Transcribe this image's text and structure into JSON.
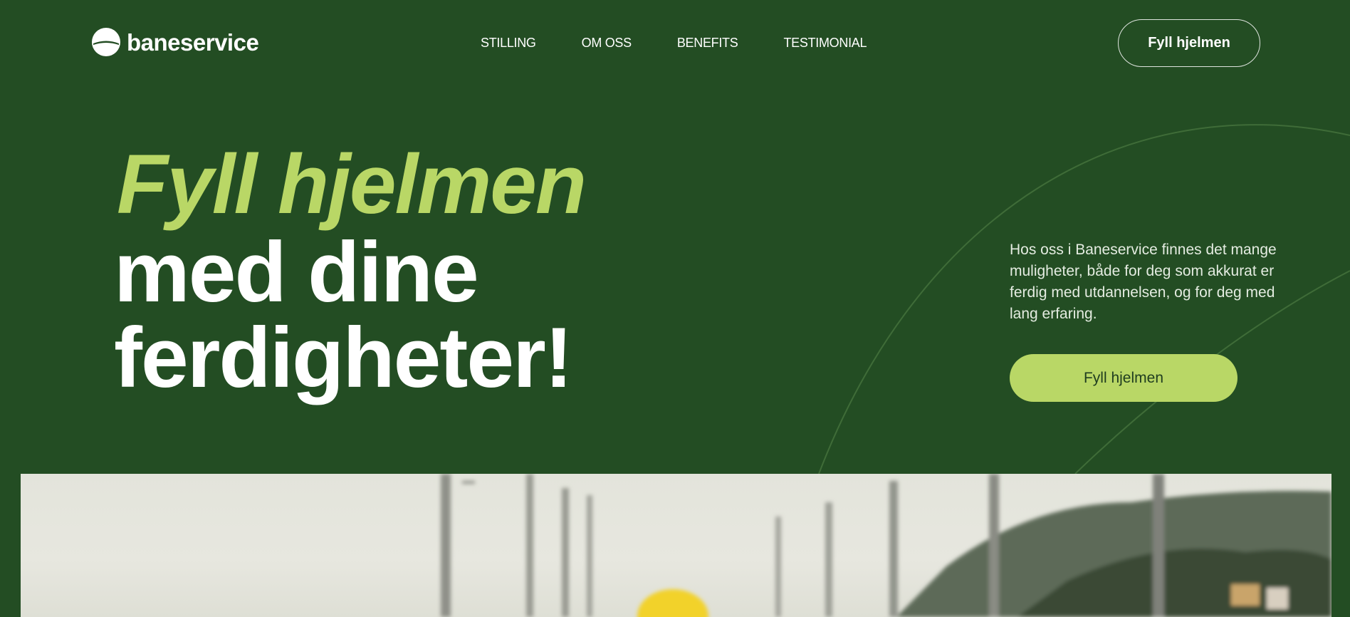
{
  "brand": {
    "name": "baneservice",
    "logo_icon": "baneservice-logo-mark"
  },
  "nav": {
    "items": [
      {
        "label": "STILLING"
      },
      {
        "label": "OM OSS"
      },
      {
        "label": "BENEFITS"
      },
      {
        "label": "TESTIMONIAL"
      }
    ]
  },
  "header": {
    "cta_label": "Fyll hjelmen"
  },
  "hero": {
    "title_line1": "Fyll hjelmen",
    "title_line2": "med dine",
    "title_line3": "ferdigheter!",
    "intro": "Hos oss i Baneservice finnes det mange muligheter, både for deg som akkurat er ferdig med utdannelsen, og for deg med lang erfaring.",
    "cta_label": "Fyll hjelmen"
  },
  "colors": {
    "background": "#234d23",
    "accent": "#b9d766",
    "text": "#ffffff"
  }
}
